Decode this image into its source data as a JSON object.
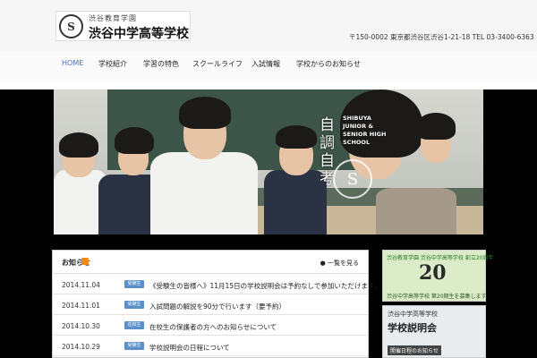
{
  "header": {
    "org": "渋谷教育学園",
    "school": "渋谷中学高等学校",
    "seal": "S",
    "address": "〒150-0002 東京都渋谷区渋谷1-21-18 TEL 03-3400-6363"
  },
  "nav": {
    "items": [
      "HOME",
      "学校紹介",
      "学習の特色",
      "スクールライフ",
      "入試情報",
      "学校からのお知らせ"
    ]
  },
  "hero": {
    "motto": "自調自考",
    "english": "SHIBUYA JUNIOR & SENIOR HIGH SCHOOL",
    "crest": "S"
  },
  "news": {
    "title": "お知らせ",
    "archive": "一覧を見る",
    "rows": [
      {
        "date": "2014.11.04",
        "badge": "受験生",
        "text": "《受験生の皆様へ》11月15日の学校説明会は予約なしで参加いただけます。"
      },
      {
        "date": "2014.11.01",
        "badge": "受験生",
        "text": "入試問題の解説を90分で行います（要予約）"
      },
      {
        "date": "2014.10.30",
        "badge": "在校生",
        "text": "在校生の保護者の方へのお知らせについて"
      },
      {
        "date": "2014.10.29",
        "badge": "受験生",
        "text": "学校説明会の日程について"
      }
    ]
  },
  "side": {
    "anniv_top": "渋谷教育学園 渋谷中学高等学校 創立20周年",
    "anniv_num": "20",
    "anniv_bottom": "渋谷中学高等学校 第20期生を募集します",
    "brief_small": "渋谷中学高等学校",
    "brief_big": "学校説明会",
    "brief_link": "開催日程のお知らせ"
  }
}
